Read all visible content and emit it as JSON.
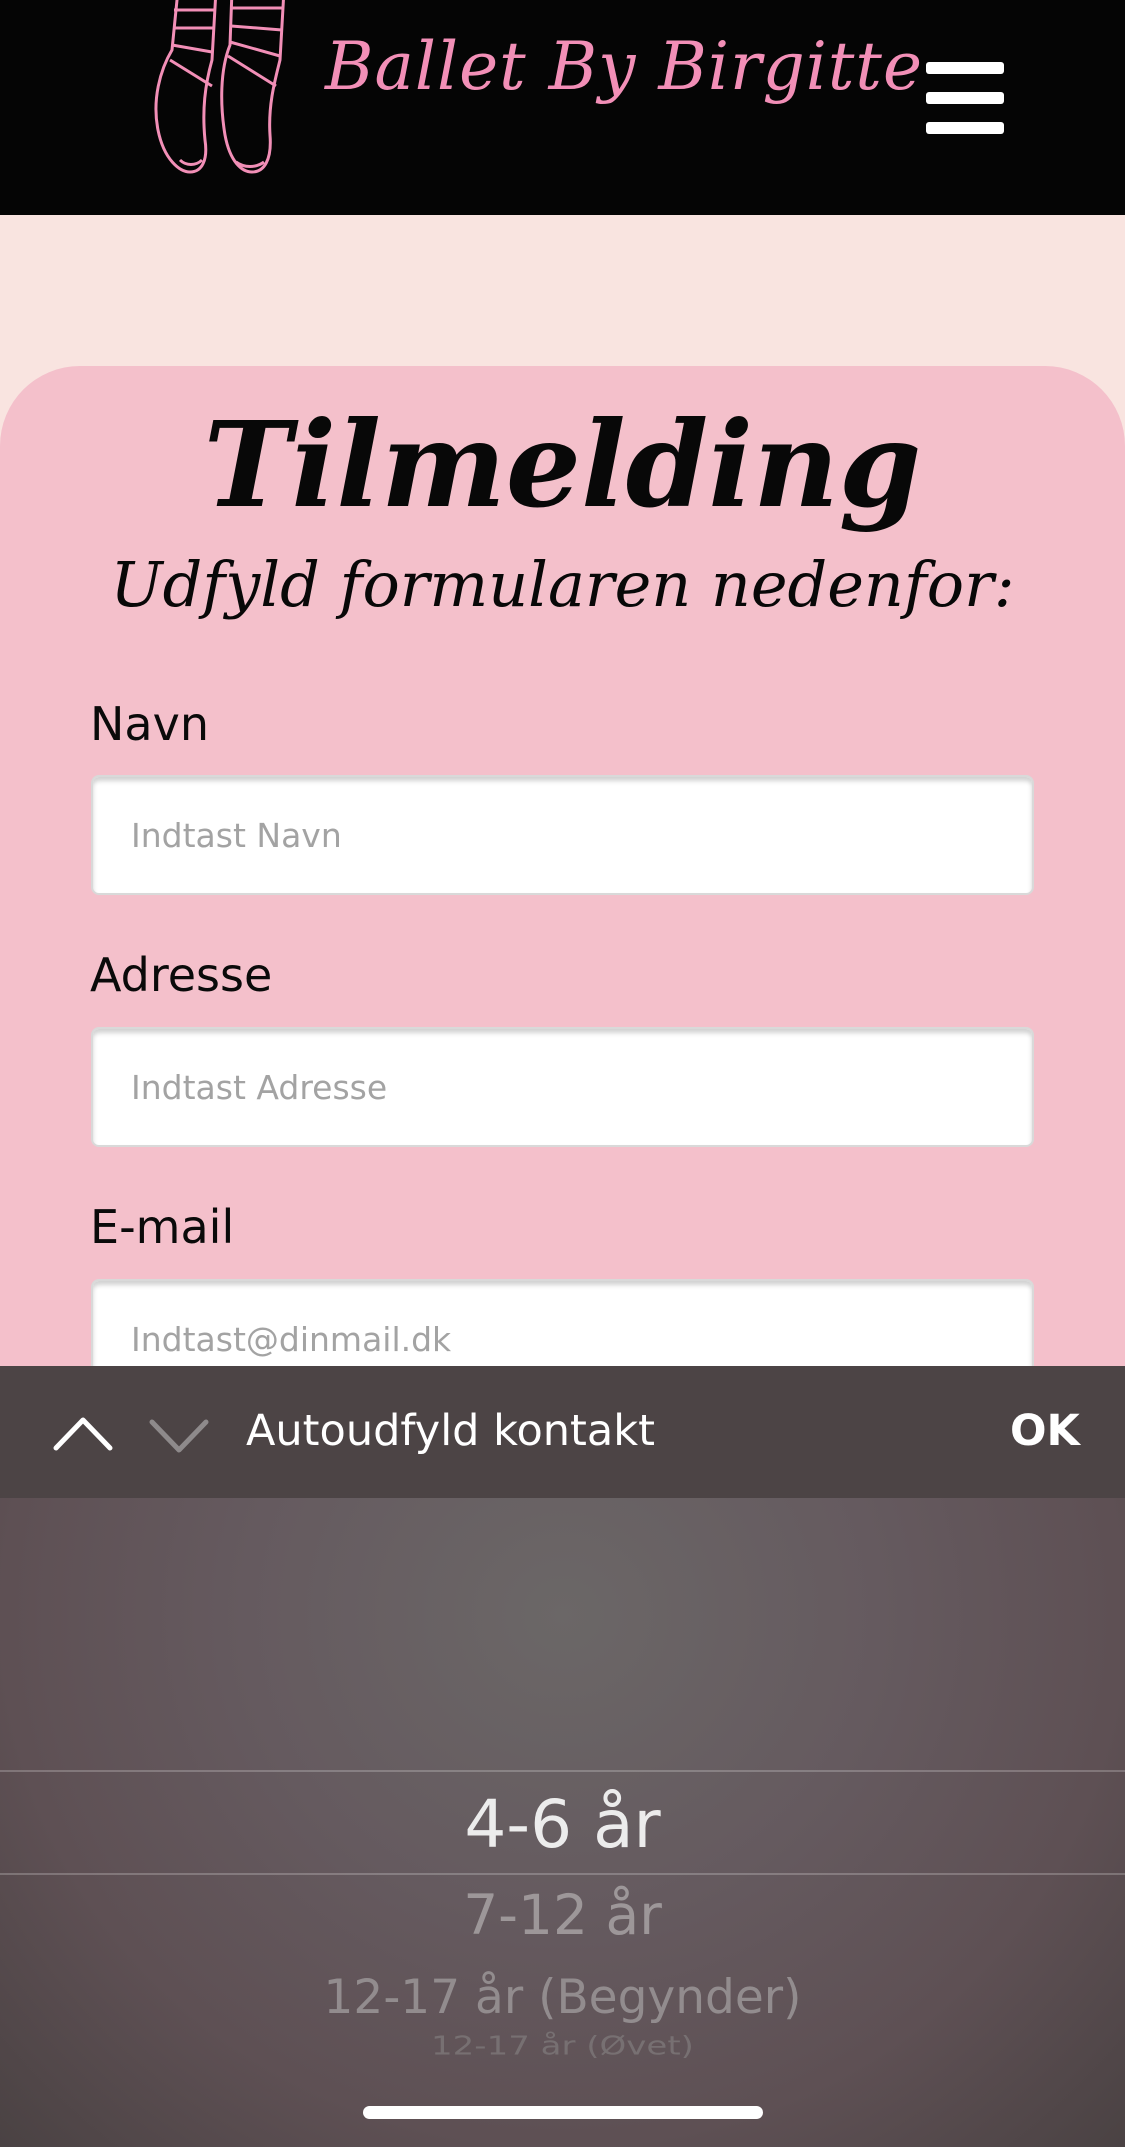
{
  "header": {
    "brand": "Ballet By Birgitte",
    "logo_icon": "pointe-shoes-icon",
    "menu_icon": "hamburger-menu-icon",
    "colors": {
      "background": "#050505",
      "brand": "#f28fb7"
    }
  },
  "form": {
    "title": "Tilmelding",
    "subtitle": "Udfyld formularen nedenfor:",
    "fields": [
      {
        "label": "Navn",
        "placeholder": "Indtast Navn",
        "value": ""
      },
      {
        "label": "Adresse",
        "placeholder": "Indtast Adresse",
        "value": ""
      },
      {
        "label": "E-mail",
        "placeholder": "Indtast@dinmail.dk",
        "value": ""
      }
    ],
    "colors": {
      "page": "#f9e4e0",
      "card": "#f4c0cb"
    }
  },
  "accessory_bar": {
    "prev_icon": "chevron-up-icon",
    "next_icon": "chevron-down-icon",
    "autofill_label": "Autoudfyld kontakt",
    "done_label": "OK"
  },
  "picker": {
    "selected": "4-6 år",
    "options": [
      "4-6 år",
      "7-12 år",
      "12-17 år (Begynder)",
      "12-17 år (Øvet)"
    ]
  }
}
